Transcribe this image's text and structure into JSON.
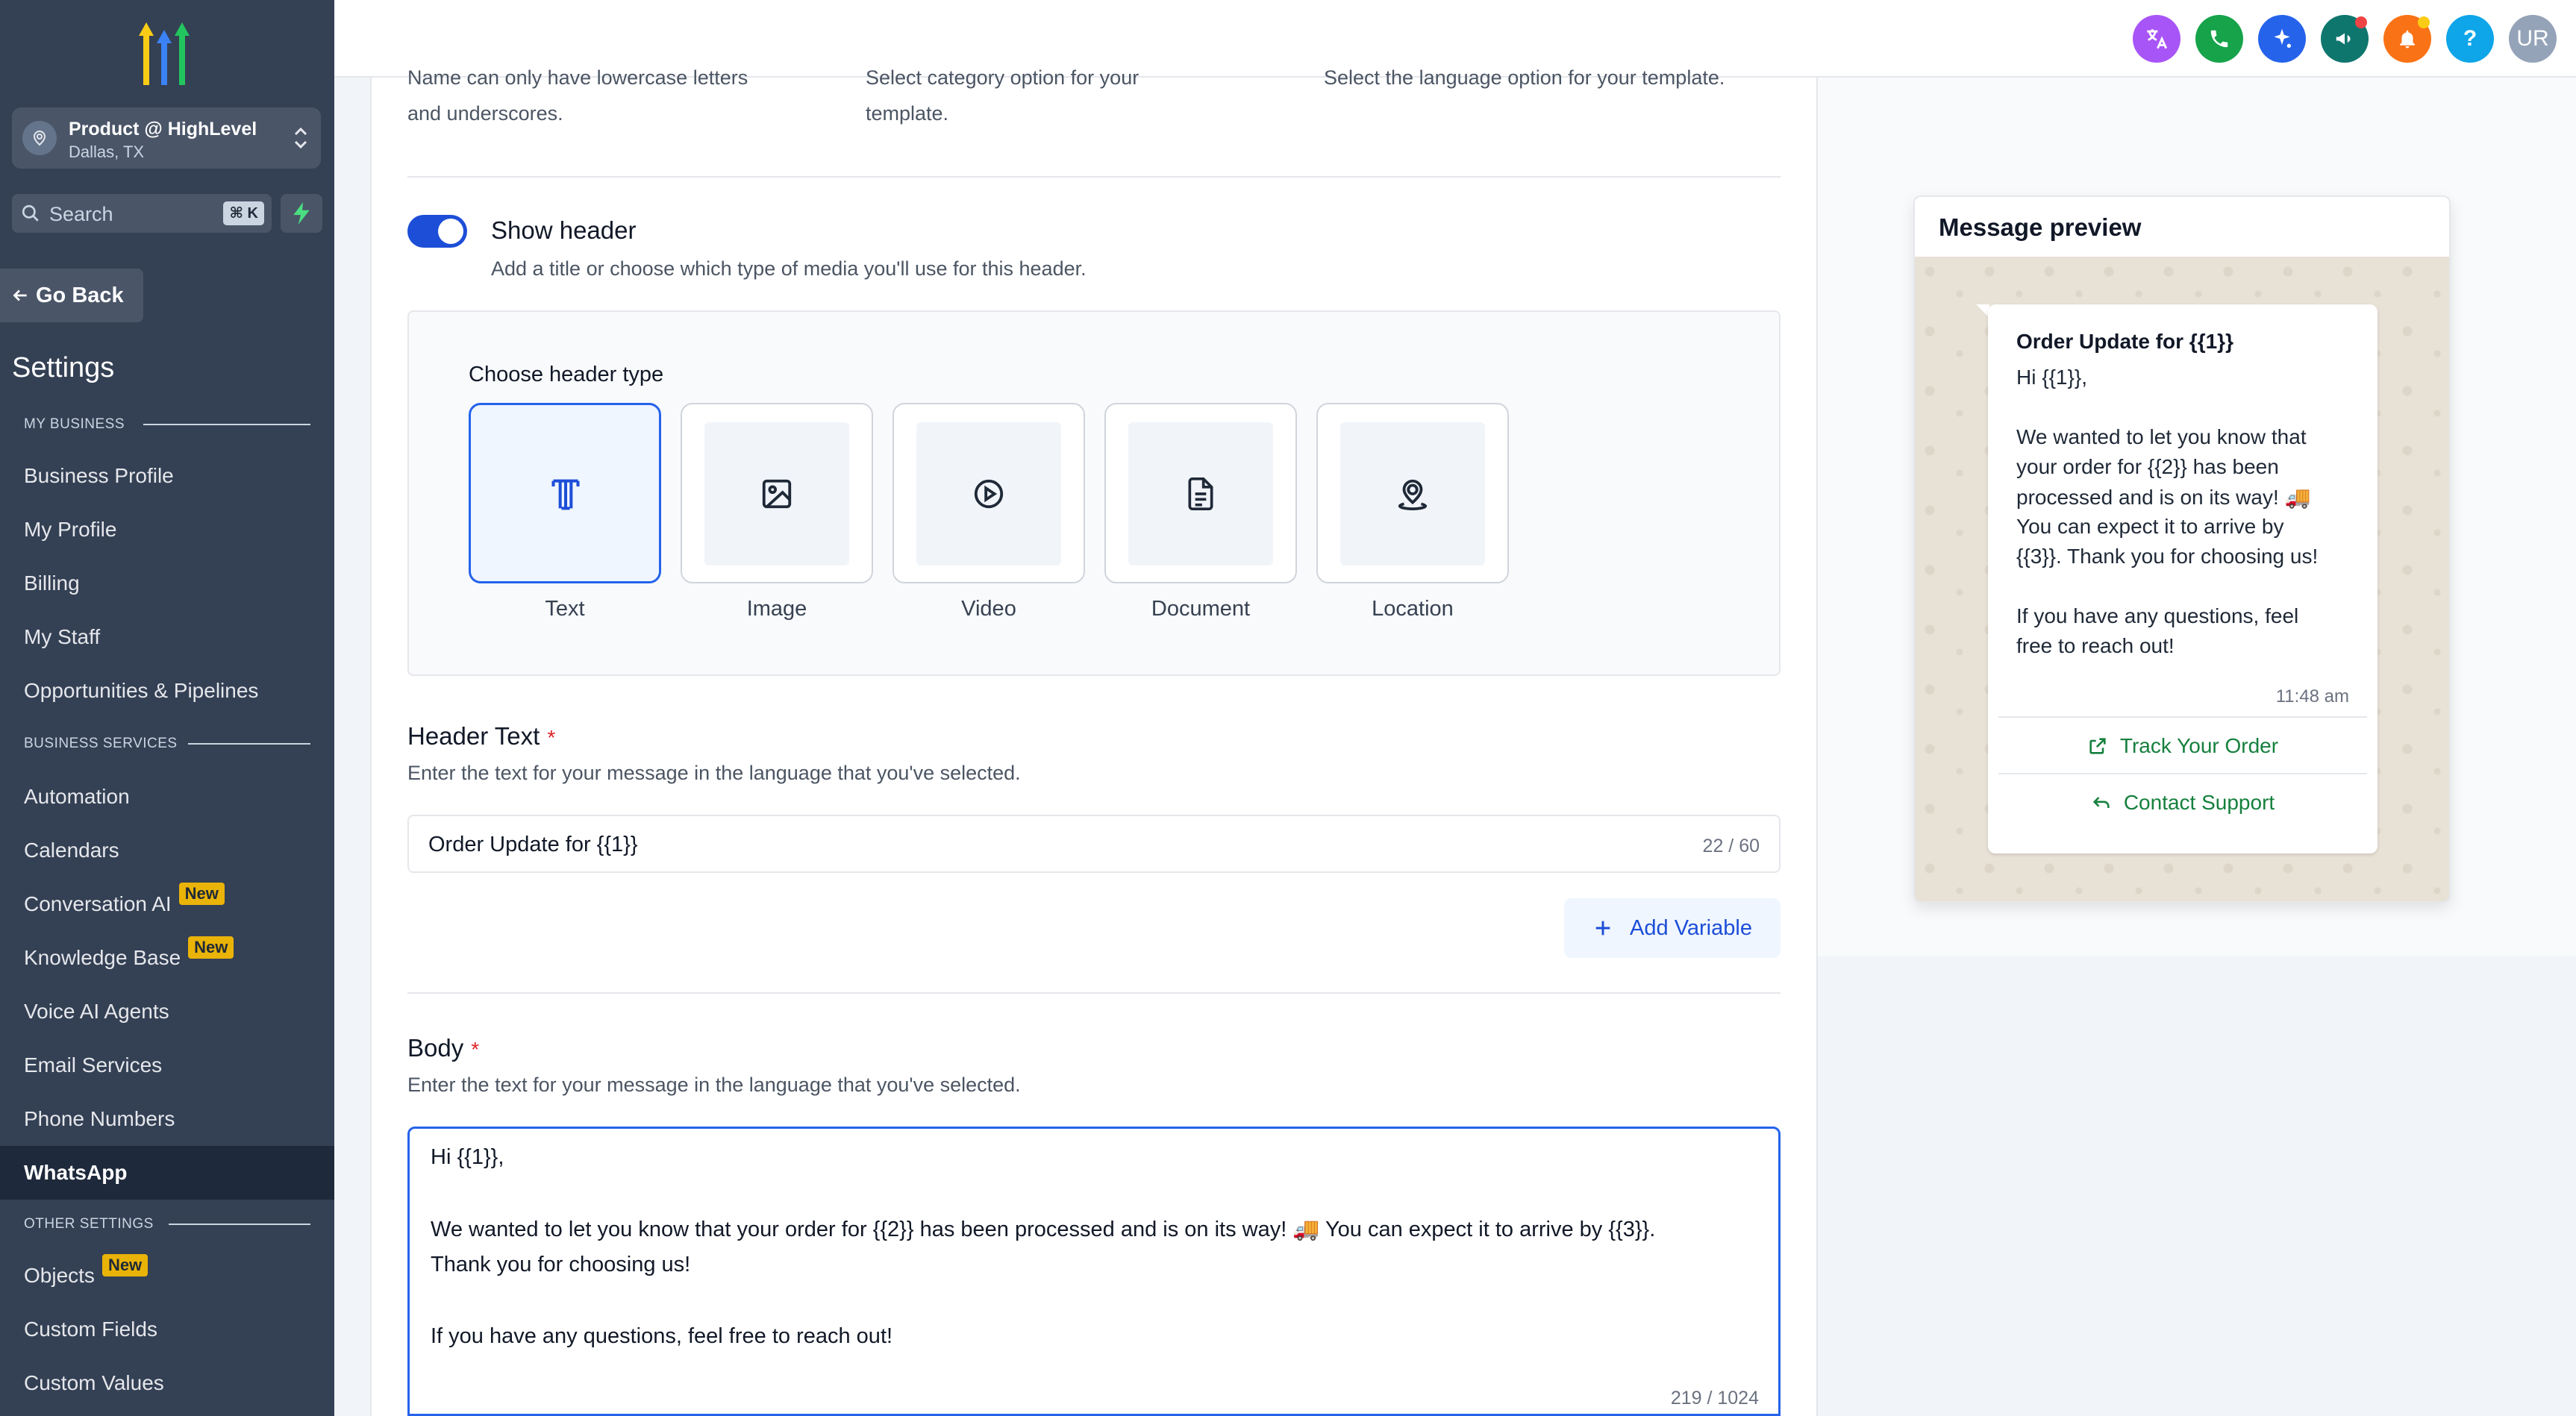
{
  "sidebar": {
    "account_name": "Product @ HighLevel",
    "account_location": "Dallas, TX",
    "search_placeholder": "Search",
    "search_shortcut": "⌘ K",
    "go_back": "Go Back",
    "settings_title": "Settings",
    "sections": {
      "my_business": "MY BUSINESS",
      "business_services": "BUSINESS SERVICES",
      "other_settings": "OTHER SETTINGS"
    },
    "items": [
      {
        "label": "Business Profile"
      },
      {
        "label": "My Profile"
      },
      {
        "label": "Billing"
      },
      {
        "label": "My Staff"
      },
      {
        "label": "Opportunities & Pipelines"
      },
      {
        "label": "Automation"
      },
      {
        "label": "Calendars"
      },
      {
        "label": "Conversation AI",
        "badge": "New"
      },
      {
        "label": "Knowledge Base",
        "badge": "New"
      },
      {
        "label": "Voice AI Agents"
      },
      {
        "label": "Email Services"
      },
      {
        "label": "Phone Numbers"
      },
      {
        "label": "WhatsApp",
        "active": true
      },
      {
        "label": "Objects",
        "badge": "New"
      },
      {
        "label": "Custom Fields"
      },
      {
        "label": "Custom Values"
      }
    ]
  },
  "topbar": {
    "user_initials": "UR",
    "help": "?",
    "colors": {
      "translate": "#a855f7",
      "phone": "#16a34a",
      "sparkle": "#2563eb",
      "megaphone": "#0f766e",
      "bell": "#f97316",
      "help": "#0ea5e9",
      "user": "#94a3b8"
    }
  },
  "form": {
    "name_hint": [
      "Name can only have lowercase letters",
      "and underscores."
    ],
    "category_hint": [
      "Select category option for your",
      "template."
    ],
    "language_hint": "Select the language option for your template.",
    "show_header_label": "Show header",
    "show_header_desc": "Add a title or choose which type of media you'll use for this header.",
    "choose_header_type": "Choose header type",
    "header_types": [
      {
        "label": "Text",
        "selected": true
      },
      {
        "label": "Image"
      },
      {
        "label": "Video"
      },
      {
        "label": "Document"
      },
      {
        "label": "Location"
      }
    ],
    "header_text_label": "Header Text",
    "required_mark": "*",
    "header_text_desc": "Enter the text for your message in the language that you've selected.",
    "header_text_value": "Order Update for {{1}}",
    "header_text_count": "22 / 60",
    "add_variable": "Add Variable",
    "body_label": "Body",
    "body_desc": "Enter the text for your message in the language that you've selected.",
    "body_lines": [
      "Hi {{1}},",
      "We wanted to let you know that your order for {{2}} has been processed and is on its way! 🚚 You can expect it to arrive by {{3}}.",
      "Thank you for choosing us!",
      "If you have any questions, feel free to reach out!"
    ],
    "body_count": "219 / 1024"
  },
  "preview": {
    "title": "Message preview",
    "header": "Order Update for {{1}}",
    "lines": [
      "Hi {{1}},",
      "We wanted to let you know that",
      "your order for {{2}} has been",
      "processed and is on its way! 🚚",
      "You can expect it to arrive by",
      "{{3}}. Thank you for choosing us!",
      "If you have any questions, feel",
      "free to reach out!"
    ],
    "time": "11:48 am",
    "buttons": [
      "Track Your Order",
      "Contact Support"
    ]
  },
  "colors": {
    "accent": "#2563eb",
    "sidebar": "#344054",
    "whatsapp_green": "#15803d",
    "required": "#dc2626",
    "badge": "#eab308"
  }
}
